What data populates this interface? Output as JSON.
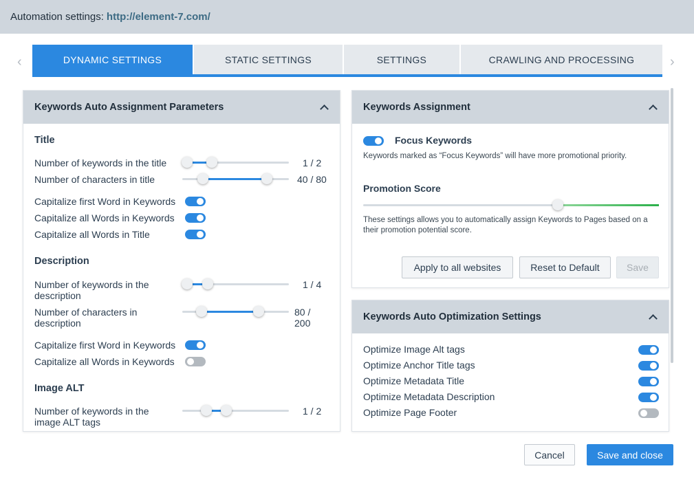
{
  "header": {
    "label": "Automation settings:",
    "url": "http://element-7.com/"
  },
  "tabs": [
    {
      "label": "DYNAMIC SETTINGS"
    },
    {
      "label": "STATIC SETTINGS"
    },
    {
      "label": "SETTINGS"
    },
    {
      "label": "CRAWLING AND PROCESSING"
    }
  ],
  "left_panel": {
    "title": "Keywords Auto Assignment Parameters",
    "title_section": {
      "heading": "Title",
      "kw_count": {
        "label": "Number of keywords in the title",
        "value": "1 / 2",
        "low": 1,
        "high": 2
      },
      "char_count": {
        "label": "Number of characters in title",
        "value": "40 / 80",
        "low": 40,
        "high": 80
      },
      "cap_first": {
        "label": "Capitalize first Word in Keywords",
        "on": true
      },
      "cap_all": {
        "label": "Capitalize all Words in Keywords",
        "on": true
      },
      "cap_title": {
        "label": "Capitalize all Words in Title",
        "on": true
      }
    },
    "desc_section": {
      "heading": "Description",
      "kw_count": {
        "label_1": "Number of keywords in the",
        "label_2": "description",
        "value": "1 / 4",
        "low": 1,
        "high": 4
      },
      "char_count": {
        "label_1": "Number of characters in",
        "label_2": "description",
        "value_1": "80 /",
        "value_2": "200",
        "low": 80,
        "high": 200
      },
      "cap_first": {
        "label": "Capitalize first Word in Keywords",
        "on": true
      },
      "cap_all": {
        "label": "Capitalize all Words in Keywords",
        "on": false
      }
    },
    "alt_section": {
      "heading": "Image ALT",
      "kw_count": {
        "label_1": "Number of keywords in the",
        "label_2": "image ALT tags",
        "value": "1 / 2",
        "low": 1,
        "high": 2
      }
    }
  },
  "assign_panel": {
    "title": "Keywords Assignment",
    "focus_label": "Focus Keywords",
    "focus_on": true,
    "focus_note": "Keywords marked as “Focus Keywords” will have more promotional priority.",
    "score_label": "Promotion Score",
    "score_note_1": "These settings allows you to automatically assign Keywords to Pages based on a",
    "score_note_2": "their promotion potential score.",
    "buttons": {
      "apply": "Apply to all websites",
      "reset": "Reset to Default",
      "save": "Save"
    }
  },
  "optimize_panel": {
    "title": "Keywords Auto Optimization Settings",
    "items": [
      {
        "label": "Optimize Image Alt tags",
        "on": true
      },
      {
        "label": "Optimize Anchor Title tags",
        "on": true
      },
      {
        "label": "Optimize Metadata Title",
        "on": true
      },
      {
        "label": "Optimize Metadata Description",
        "on": true
      },
      {
        "label": "Optimize Page Footer",
        "on": false
      }
    ]
  },
  "footer": {
    "cancel": "Cancel",
    "save_close": "Save and close"
  },
  "colors": {
    "accent": "#2b88e0",
    "header_bg": "#cfd6dd",
    "score_green": "#2bb04a"
  }
}
